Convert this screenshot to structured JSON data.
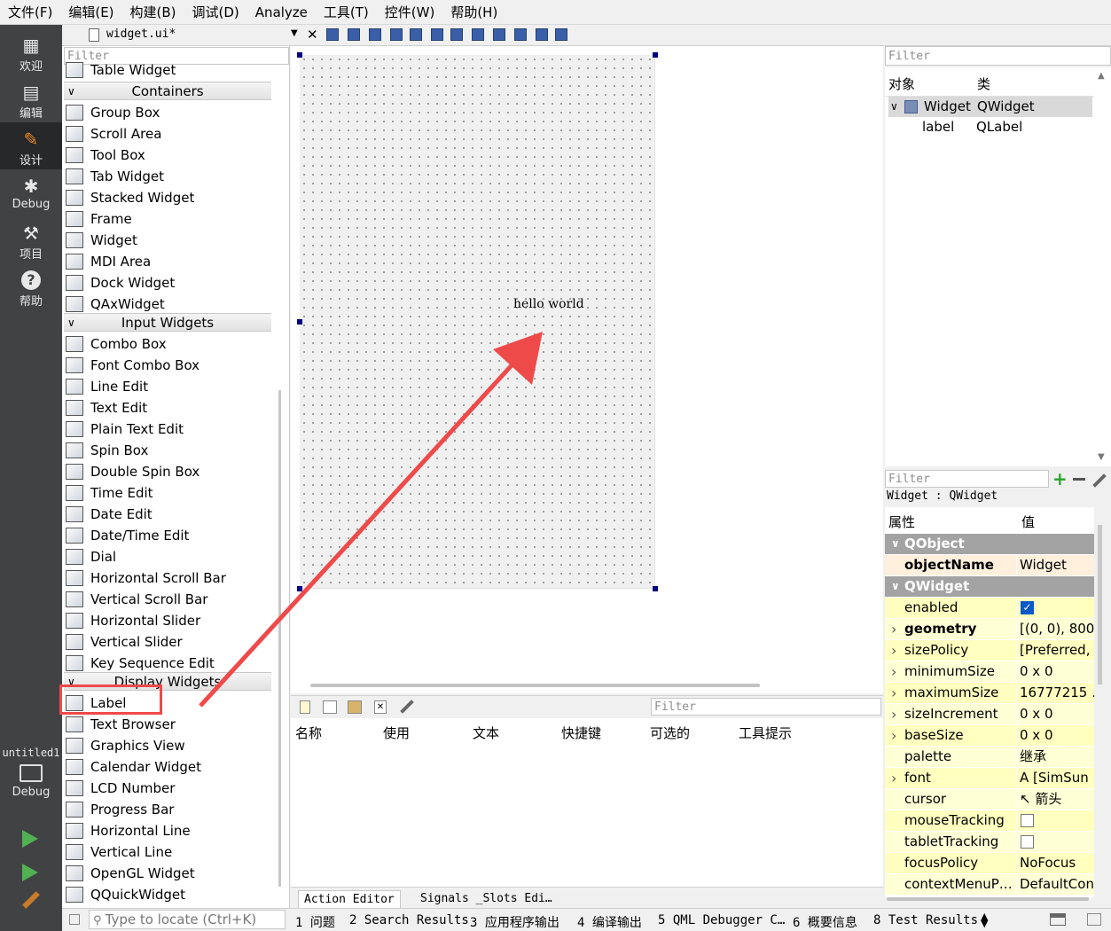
{
  "menubar": [
    "文件(F)",
    "编辑(E)",
    "构建(B)",
    "调试(D)",
    "Analyze",
    "工具(T)",
    "控件(W)",
    "帮助(H)"
  ],
  "modes": [
    {
      "label": "欢迎",
      "icon": "grid-icon"
    },
    {
      "label": "编辑",
      "icon": "document-icon"
    },
    {
      "label": "设计",
      "icon": "pencil-icon",
      "active": true
    },
    {
      "label": "Debug",
      "icon": "bug-icon"
    },
    {
      "label": "项目",
      "icon": "wrench-icon"
    },
    {
      "label": "帮助",
      "icon": "help-icon"
    }
  ],
  "kit": {
    "name": "untitled1",
    "label": "Debug"
  },
  "toolbar": {
    "file_tab": "widget.ui*"
  },
  "widget_box": {
    "filter_placeholder": "Filter",
    "partial_item": "Table Widget",
    "categories": [
      {
        "name": "Containers",
        "items": [
          "Group Box",
          "Scroll Area",
          "Tool Box",
          "Tab Widget",
          "Stacked Widget",
          "Frame",
          "Widget",
          "MDI Area",
          "Dock Widget",
          "QAxWidget"
        ]
      },
      {
        "name": "Input Widgets",
        "items": [
          "Combo Box",
          "Font Combo Box",
          "Line Edit",
          "Text Edit",
          "Plain Text Edit",
          "Spin Box",
          "Double Spin Box",
          "Time Edit",
          "Date Edit",
          "Date/Time Edit",
          "Dial",
          "Horizontal Scroll Bar",
          "Vertical Scroll Bar",
          "Horizontal Slider",
          "Vertical Slider",
          "Key Sequence Edit"
        ]
      },
      {
        "name": "Display Widgets",
        "items": [
          "Label",
          "Text Browser",
          "Graphics View",
          "Calendar Widget",
          "LCD Number",
          "Progress Bar",
          "Horizontal Line",
          "Vertical Line",
          "OpenGL Widget",
          "QQuickWidget"
        ]
      }
    ]
  },
  "form": {
    "label_text": "hello world"
  },
  "action_editor": {
    "filter_placeholder": "Filter",
    "headers": [
      "名称",
      "使用",
      "文本",
      "快捷键",
      "可选的",
      "工具提示"
    ],
    "tabs": [
      "Action Editor",
      "Signals _Slots Edi…"
    ]
  },
  "object_inspector": {
    "filter_placeholder": "Filter",
    "headers": [
      "对象",
      "类"
    ],
    "rows": [
      {
        "object": "Widget",
        "class": "QWidget"
      },
      {
        "object": "label",
        "class": "QLabel"
      }
    ]
  },
  "property_editor": {
    "filter_placeholder": "Filter",
    "class_line": "Widget : QWidget",
    "headers": [
      "属性",
      "值"
    ],
    "rows": [
      {
        "type": "group",
        "name": "QObject"
      },
      {
        "type": "prop",
        "name": "objectName",
        "value": "Widget",
        "bold": true,
        "style": "o1"
      },
      {
        "type": "group",
        "name": "QWidget"
      },
      {
        "type": "prop",
        "name": "enabled",
        "check": true,
        "style": "y1"
      },
      {
        "type": "prop",
        "name": "geometry",
        "value": "[(0, 0), 800 …",
        "bold": true,
        "expand": true,
        "style": "y2"
      },
      {
        "type": "prop",
        "name": "sizePolicy",
        "value": "[Preferred, …",
        "expand": true,
        "style": "y1"
      },
      {
        "type": "prop",
        "name": "minimumSize",
        "value": "0 x 0",
        "expand": true,
        "style": "y2"
      },
      {
        "type": "prop",
        "name": "maximumSize",
        "value": "16777215 …",
        "expand": true,
        "style": "y1"
      },
      {
        "type": "prop",
        "name": "sizeIncrement",
        "value": "0 x 0",
        "expand": true,
        "style": "y2"
      },
      {
        "type": "prop",
        "name": "baseSize",
        "value": "0 x 0",
        "expand": true,
        "style": "y1"
      },
      {
        "type": "prop",
        "name": "palette",
        "value": "继承",
        "style": "y2"
      },
      {
        "type": "prop",
        "name": "font",
        "value": "A  [SimSun",
        "expand": true,
        "style": "y1"
      },
      {
        "type": "prop",
        "name": "cursor",
        "value": "↖ 箭头",
        "style": "y2"
      },
      {
        "type": "prop",
        "name": "mouseTracking",
        "check": false,
        "style": "y1"
      },
      {
        "type": "prop",
        "name": "tabletTracking",
        "check": false,
        "style": "y2"
      },
      {
        "type": "prop",
        "name": "focusPolicy",
        "value": "NoFocus",
        "style": "y1"
      },
      {
        "type": "prop",
        "name": "contextMenuP…",
        "value": "DefaultCon",
        "style": "y2"
      }
    ]
  },
  "status_bar": {
    "locate_placeholder": "Type to locate (Ctrl+K)",
    "tabs": [
      "1 问题",
      "2 Search Results",
      "3 应用程序输出",
      "4 编译输出",
      "5 QML Debugger C…",
      "6 概要信息",
      "8 Test Results"
    ]
  },
  "colors": {
    "mode_bar": "#404244",
    "mode_active": "#262829",
    "highlight": "#ef4a4a",
    "selection_handle": "#000080",
    "property_group": "#a3a3a3"
  }
}
